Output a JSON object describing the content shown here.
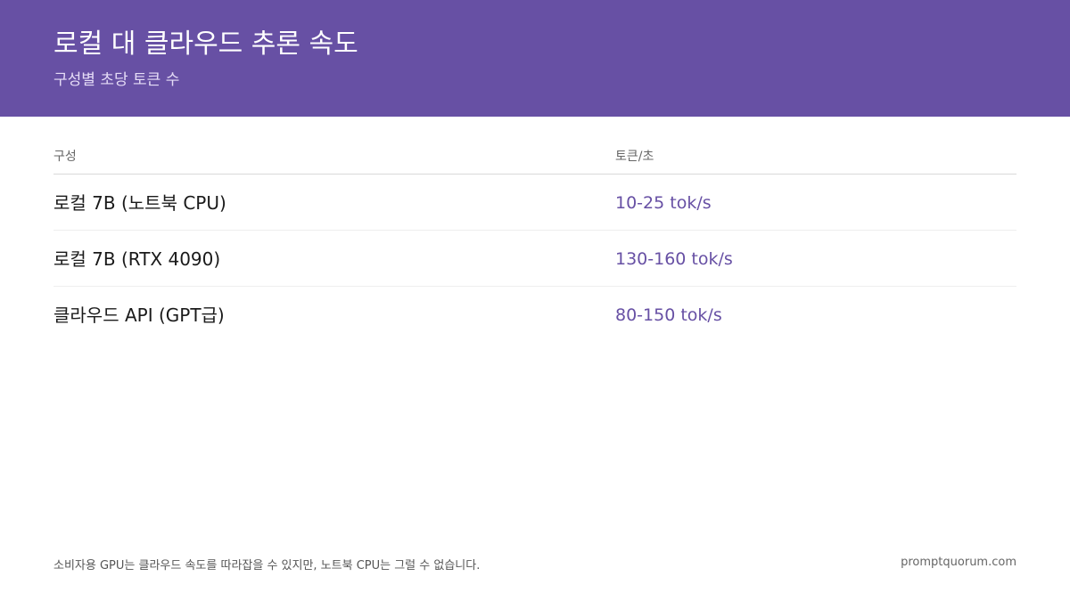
{
  "header": {
    "title": "로컬 대 클라우드 추론 속도",
    "subtitle": "구성별 초당 토큰 수"
  },
  "table": {
    "columns": [
      "구성",
      "토큰/초"
    ],
    "rows": [
      {
        "config": "로컬 7B (노트북 CPU)",
        "speed": "10-25 tok/s"
      },
      {
        "config": "로컬 7B (RTX 4090)",
        "speed": "130-160 tok/s"
      },
      {
        "config": "클라우드 API (GPT급)",
        "speed": "80-150 tok/s"
      }
    ]
  },
  "footer": {
    "note": "소비자용 GPU는 클라우드 속도를 따라잡을 수 있지만, 노트북 CPU는 그럴 수 없습니다.",
    "brand": "promptquorum.com"
  },
  "colors": {
    "accent": "#6750a4",
    "header_bg": "#6750a4"
  }
}
